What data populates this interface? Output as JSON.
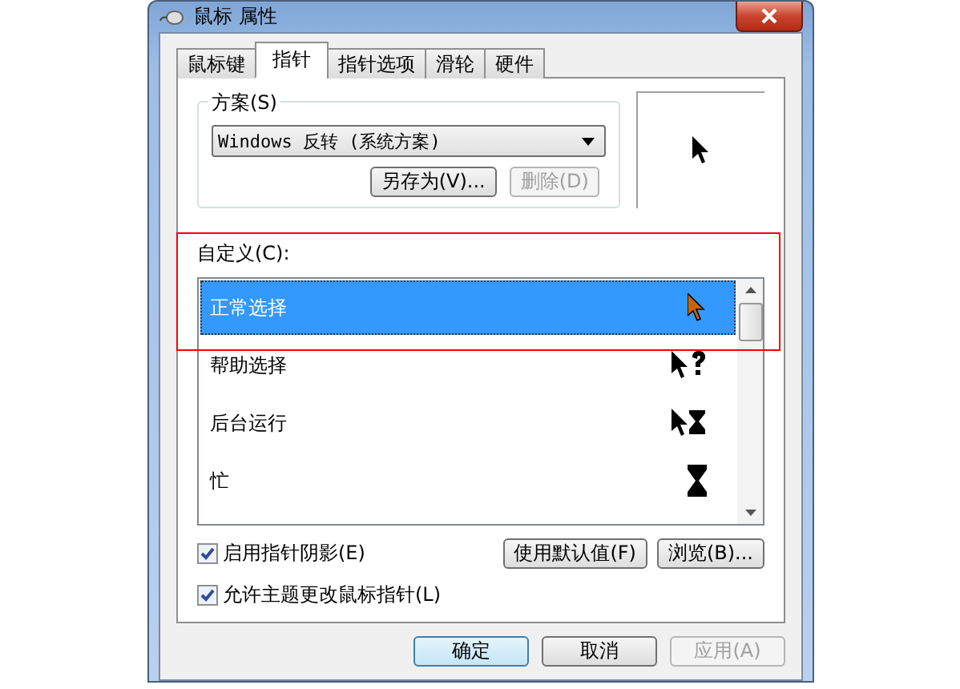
{
  "window": {
    "title": "鼠标 属性"
  },
  "tabs": [
    {
      "label": "鼠标键",
      "selected": false
    },
    {
      "label": "指针",
      "selected": true
    },
    {
      "label": "指针选项",
      "selected": false
    },
    {
      "label": "滑轮",
      "selected": false
    },
    {
      "label": "硬件",
      "selected": false
    }
  ],
  "scheme": {
    "label": "方案(S)",
    "value": "Windows 反转 (系统方案)",
    "buttons": [
      {
        "label": "另存为(V)...",
        "disabled": false
      },
      {
        "label": "删除(D)",
        "disabled": true
      }
    ]
  },
  "custom": {
    "label": "自定义(C):",
    "items": [
      {
        "name": "正常选择",
        "selected": true,
        "kind": "arrow"
      },
      {
        "name": "帮助选择",
        "selected": false,
        "kind": "help"
      },
      {
        "name": "后台运行",
        "selected": false,
        "kind": "working"
      },
      {
        "name": "忙",
        "selected": false,
        "kind": "busy"
      }
    ]
  },
  "options": [
    {
      "label": "启用指针阴影(E)",
      "checked": true
    },
    {
      "label": "允许主题更改鼠标指针(L)",
      "checked": true
    }
  ],
  "list_buttons": [
    "使用默认值(F)",
    "浏览(B)..."
  ],
  "dialog_buttons": [
    {
      "label": "确定",
      "disabled": false,
      "default": true
    },
    {
      "label": "取消",
      "disabled": false,
      "default": false
    },
    {
      "label": "应用(A)",
      "disabled": true,
      "default": false
    }
  ]
}
